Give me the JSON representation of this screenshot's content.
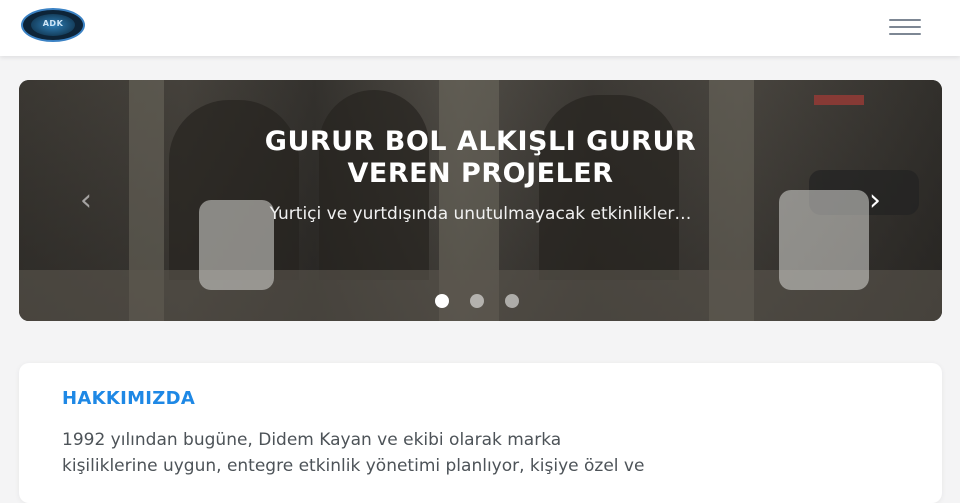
{
  "header": {
    "logo_text": "ADK",
    "menu_icon": "hamburger-menu-icon"
  },
  "hero": {
    "title_line1": "GURUR BOL ALKIŞLI GURUR",
    "title_line2": "VEREN PROJELER",
    "subtitle": "Yurtiçi ve yurtdışında unutulmayacak etkinlikler…",
    "prev_label": "‹",
    "next_label": "›",
    "slide_count": 3,
    "active_slide": 1
  },
  "about": {
    "title": "HAKKIMIZDA",
    "line1": "1992 yılından bugüne, Didem Kayan ve ekibi olarak marka",
    "line2": "kişiliklerine uygun, entegre etkinlik yönetimi planlıyor, kişiye özel ve"
  },
  "colors": {
    "accent": "#1e88e5",
    "header_bg": "#ffffff",
    "page_bg": "#f4f4f5"
  }
}
